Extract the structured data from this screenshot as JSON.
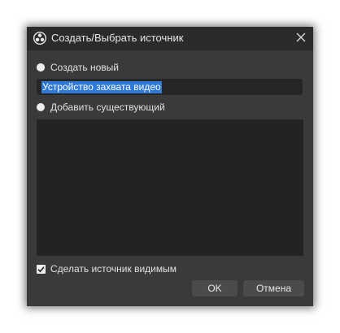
{
  "dialog": {
    "title": "Создать/Выбрать источник",
    "option_create_label": "Создать новый",
    "name_input_value": "Устройство захвата видео",
    "option_existing_label": "Добавить существующий",
    "make_visible_label": "Сделать источник видимым",
    "make_visible_checked": true,
    "ok_label": "OK",
    "cancel_label": "Отмена"
  },
  "icons": {
    "title": "obs-logo-icon",
    "close": "close-icon",
    "check": "checkmark-icon"
  },
  "colors": {
    "window_bg": "#3a3a3a",
    "titlebar_bg": "#2b2b2b",
    "input_bg": "#262626",
    "selection": "#2f7ad8",
    "list_bg": "#232323",
    "button_bg": "#4b4b4b"
  }
}
